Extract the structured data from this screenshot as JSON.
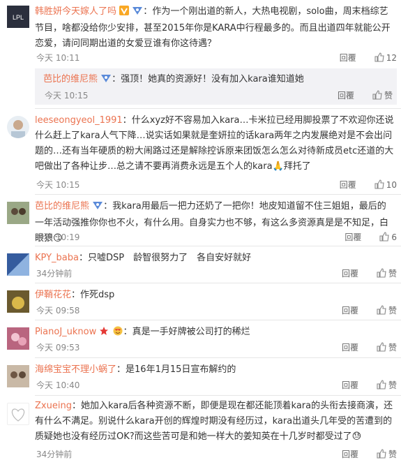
{
  "colors": {
    "name": "#eb7350",
    "meta": "#888888",
    "sub_bg": "#f2f2f5"
  },
  "comments": [
    {
      "user": "韩胜妍今天嫁人了吗",
      "badges": [
        "v-badge",
        "vip-badge"
      ],
      "text": "作为一个刚出道的新人，大热电视剧，solo曲，周末档综艺节目，啥都没给你少安排，甚至2015年你是KARA中行程最多的。而且出道四年就能公开恋爱，请问同期出道的女爱豆谁有你这待遇？",
      "time": "今天 10:11",
      "reply": "回覆",
      "likes": "12"
    },
    {
      "user": "芭比的维尼熊",
      "badges": [
        "vip-badge"
      ],
      "text": "强顶！她真的资源好！没有加入kara谁知道她",
      "time": "今天 10:15",
      "reply": "回覆",
      "likes": "赞"
    },
    {
      "user": "leeseongyeol_1991",
      "badges": [],
      "text": "什么xyz好不容易加入kara…卡米拉已经用脚投票了不欢迎你还说什么赶上了kara人气下降…说实话如果就是奎妍拉的话kara两年之内发展绝对是不会出问题的…还有当年硬质的粉大闹路过还是解除控诉原来团饭怎么怎么对待新成员etc还道的大吧做出了各种让步…总之请不要再消费永远是五个人的kara",
      "emoji_end": "🙏",
      "tail": "拜托了",
      "time": "今天 10:15",
      "reply": "回覆",
      "likes": "10"
    },
    {
      "user": "芭比的维尼熊",
      "badges": [
        "vip-badge"
      ],
      "text": "我kara用最后一把力还奶了一把你！地皮知道留不住三姐姐，最后的一年活动强推你你也不火，有什么用。自身实力也不够，有这么多资源真是是不知足，白眼狼",
      "emoji_end": "😏",
      "time": "今天 10:19",
      "reply": "回覆",
      "likes": "6"
    },
    {
      "user": "KPY_baba",
      "badges": [],
      "text": "只嘘DSP　龄智很努力了　各自安好就好",
      "time": "34分钟前",
      "reply": "回覆",
      "likes": "赞"
    },
    {
      "user": "伊鞘花花",
      "badges": [],
      "text": "作死dsp",
      "time": "今天 09:58",
      "reply": "回覆",
      "likes": "赞"
    },
    {
      "user": "PianoJ_uknow",
      "badges": [
        "star-badge",
        "heart-emoji"
      ],
      "text": "真是一手好牌被公司打的稀烂",
      "time": "今天 09:53",
      "reply": "回覆",
      "likes": "赞"
    },
    {
      "user": "海绵宝宝不理小蜗了",
      "badges": [],
      "text": "是16年1月15日宣布解约的",
      "time": "今天 10:40",
      "reply": "回覆",
      "likes": "赞"
    },
    {
      "user": "Zxueing",
      "badges": [],
      "text": "她加入kara后各种资源不断，即便是现在都还能顶着kara的头衔去接商演，还有什么不满足。别说什么kara开创的辉煌时期没有经历过，kara出道头几年受的苦遭到的质疑她也没有经历过OK?而这些苦可是和她一样大的姜知英在十几岁时都受过了",
      "emoji_end": "😓",
      "time": "34分钟前",
      "reply": "回覆",
      "likes": "赞"
    }
  ]
}
